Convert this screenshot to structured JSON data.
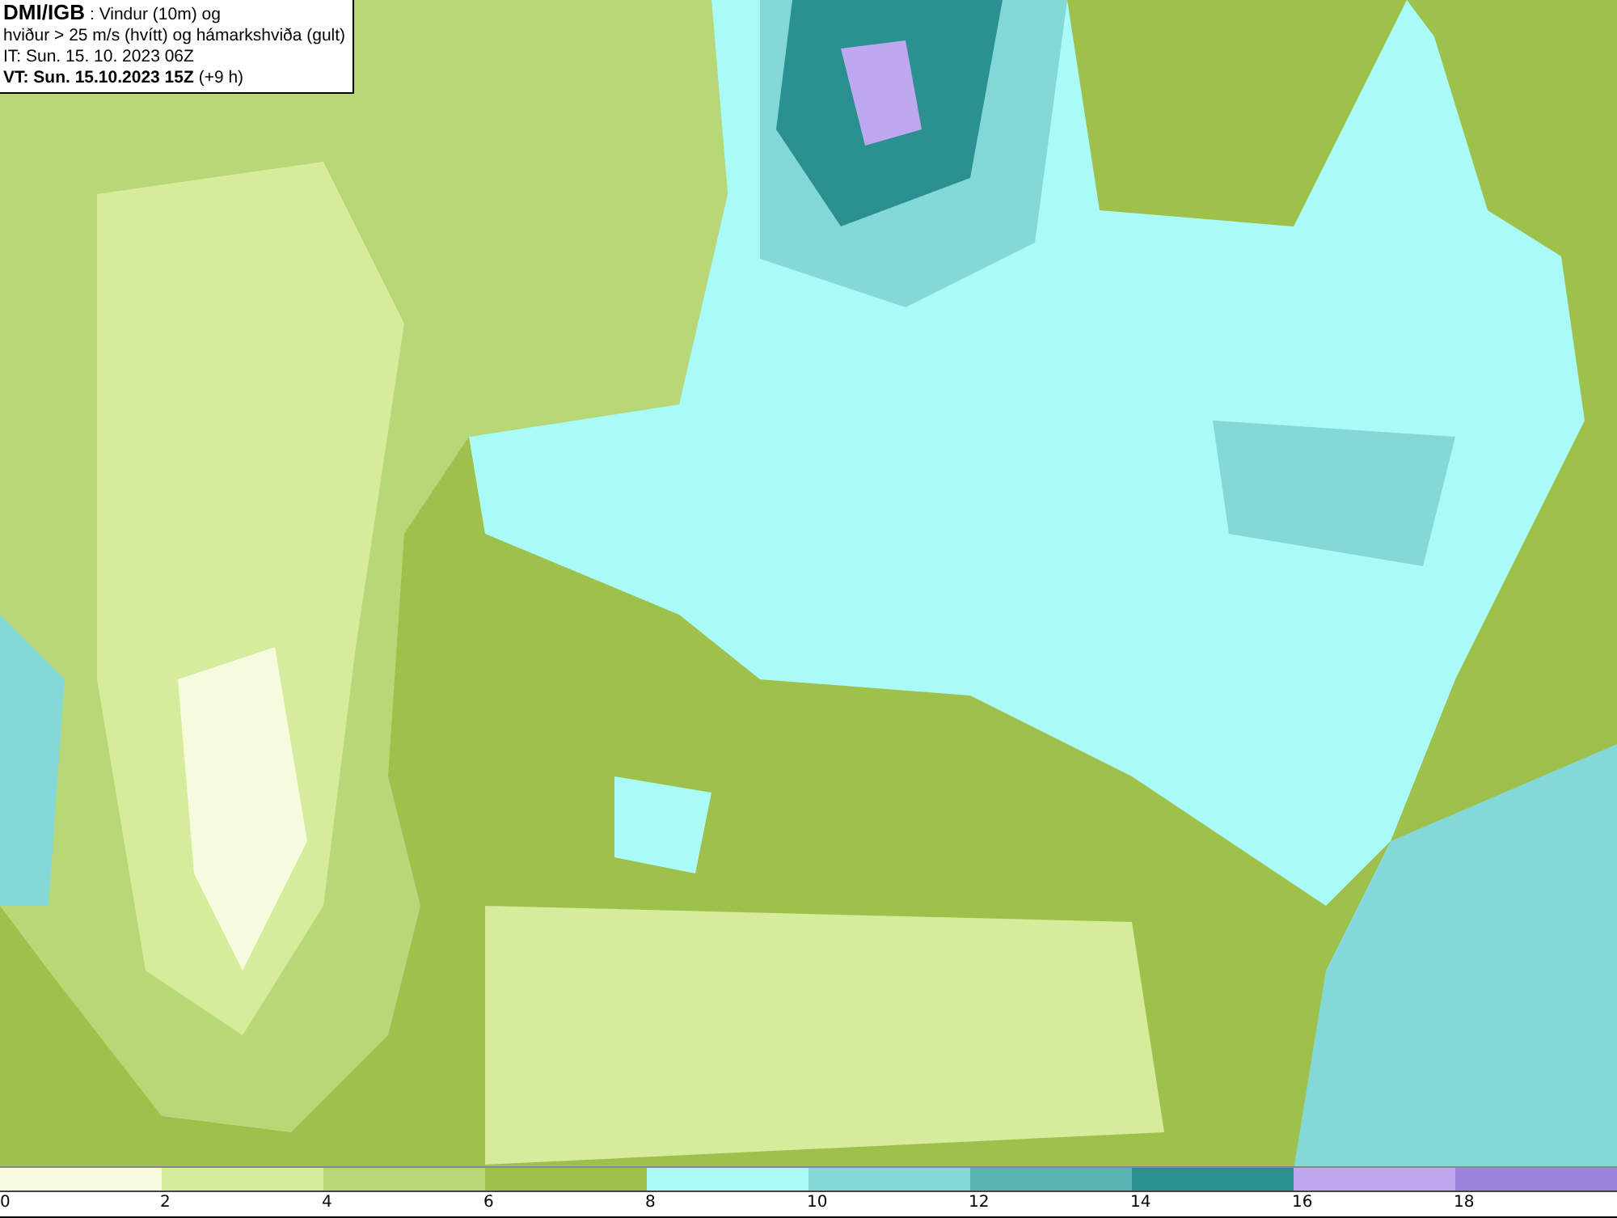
{
  "header": {
    "lines": [
      "**DMI/IGB** : Vindur (10m) og",
      "hviður > 25 m/s (hvítt) og hámarkshviða (gult)",
      "IT: Sun. 15. 10. 2023 06Z",
      "**VT: Sun. 15.10.2023 15Z** (+9 h)"
    ]
  },
  "legend": {
    "segments": [
      {
        "label": "0",
        "color": "#f5fbdc"
      },
      {
        "label": "2",
        "color": "#d6ec9c"
      },
      {
        "label": "4",
        "color": "#b8d878"
      },
      {
        "label": "6",
        "color": "#9dc14a"
      },
      {
        "label": "8",
        "color": "#aafaf8"
      },
      {
        "label": "10",
        "color": "#84d8d8"
      },
      {
        "label": "12",
        "color": "#5ab4b4"
      },
      {
        "label": "14",
        "color": "#2a9090"
      },
      {
        "label": "16",
        "color": "#c0a8f0"
      },
      {
        "label": "18",
        "color": "#9a84de"
      }
    ]
  }
}
